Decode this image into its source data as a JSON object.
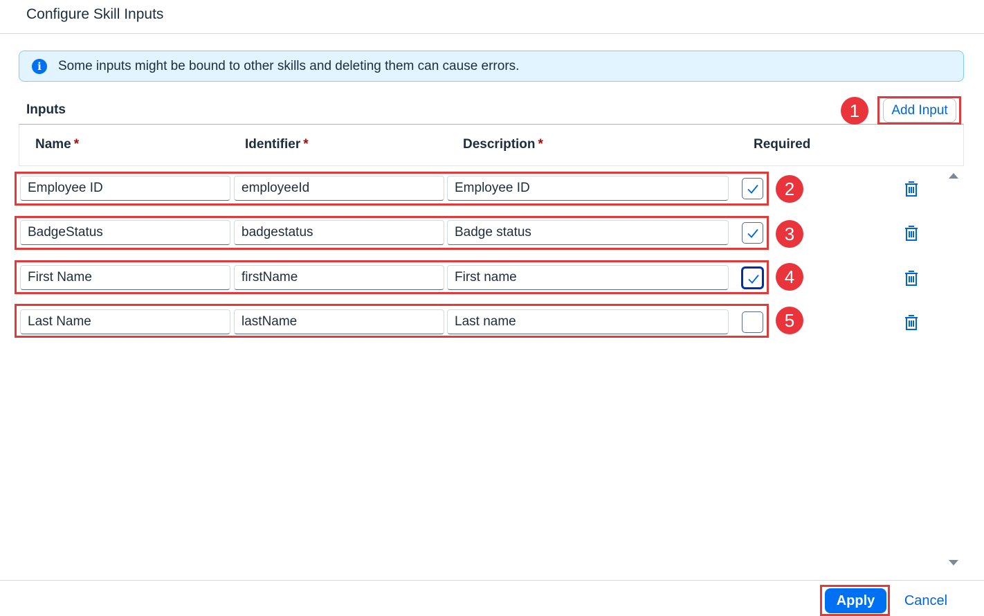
{
  "dialog": {
    "title": "Configure Skill Inputs"
  },
  "info_strip": {
    "icon": "info-icon",
    "message": "Some inputs might be bound to other skills and deleting them can cause errors."
  },
  "inputs_section": {
    "title": "Inputs",
    "add_button_label": "Add Input"
  },
  "table": {
    "columns": [
      {
        "label": "Name",
        "required_marker": "*"
      },
      {
        "label": "Identifier",
        "required_marker": "*"
      },
      {
        "label": "Description",
        "required_marker": "*"
      },
      {
        "label": "Required",
        "required_marker": ""
      }
    ],
    "rows": [
      {
        "name": "Employee ID",
        "identifier": "employeeId",
        "description": "Employee ID",
        "required": true
      },
      {
        "name": "BadgeStatus",
        "identifier": "badgestatus",
        "description": "Badge status",
        "required": true
      },
      {
        "name": "First Name",
        "identifier": "firstName",
        "description": "First name",
        "required": true
      },
      {
        "name": "Last Name",
        "identifier": "lastName",
        "description": "Last name",
        "required": false
      }
    ]
  },
  "footer": {
    "apply_label": "Apply",
    "cancel_label": "Cancel"
  },
  "annotations": {
    "badges": [
      "1",
      "2",
      "3",
      "4",
      "5"
    ],
    "highlight_color": "#e23a3a",
    "badge_color": "#e8343a"
  },
  "colors": {
    "accent": "#0070f2",
    "link": "#0064d9",
    "info_bg": "#e1f4ff",
    "required_star": "#aa0808"
  }
}
